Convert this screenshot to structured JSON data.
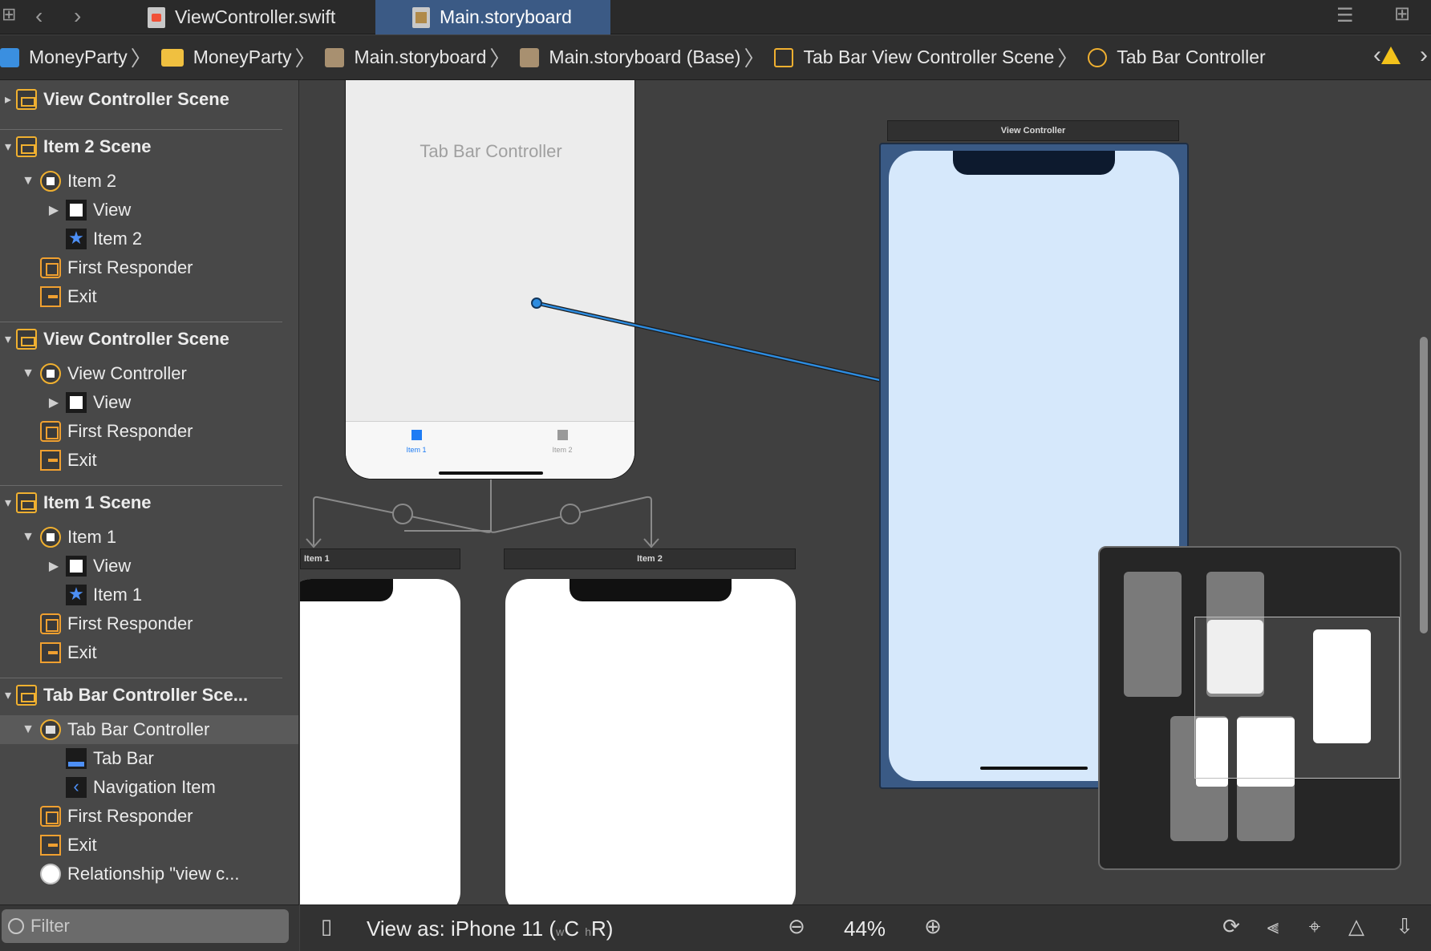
{
  "tabs": [
    {
      "label": "ViewController.swift",
      "active": false,
      "icon": "swift-file-icon"
    },
    {
      "label": "Main.storyboard",
      "active": true,
      "icon": "storyboard-file-icon"
    }
  ],
  "breadcrumb": [
    {
      "label": "MoneyParty",
      "icon": "app-icon"
    },
    {
      "label": "MoneyParty",
      "icon": "folder-icon"
    },
    {
      "label": "Main.storyboard",
      "icon": "storyboard-file-icon"
    },
    {
      "label": "Main.storyboard (Base)",
      "icon": "storyboard-file-icon"
    },
    {
      "label": "Tab Bar View Controller Scene",
      "icon": "scene-icon"
    },
    {
      "label": "Tab Bar Controller",
      "icon": "tab-bar-controller-icon"
    }
  ],
  "outline": {
    "rows": [
      {
        "label": "View Controller Scene",
        "indent": 0,
        "icon": "scene",
        "tri": "▸",
        "bold": true
      },
      {
        "label": "Item 2 Scene",
        "indent": 0,
        "icon": "scene",
        "tri": "▾",
        "bold": true
      },
      {
        "label": "Item 2",
        "indent": 1,
        "icon": "vc",
        "tri": "▼"
      },
      {
        "label": "View",
        "indent": 2,
        "icon": "view",
        "tri": "▶"
      },
      {
        "label": "Item 2",
        "indent": 2,
        "icon": "star",
        "tri": ""
      },
      {
        "label": "First Responder",
        "indent": 1,
        "icon": "cube",
        "tri": ""
      },
      {
        "label": "Exit",
        "indent": 1,
        "icon": "exit",
        "tri": ""
      },
      {
        "label": "View Controller Scene",
        "indent": 0,
        "icon": "scene",
        "tri": "▾",
        "bold": true
      },
      {
        "label": "View Controller",
        "indent": 1,
        "icon": "vc",
        "tri": "▼"
      },
      {
        "label": "View",
        "indent": 2,
        "icon": "view",
        "tri": "▶"
      },
      {
        "label": "First Responder",
        "indent": 1,
        "icon": "cube",
        "tri": ""
      },
      {
        "label": "Exit",
        "indent": 1,
        "icon": "exit",
        "tri": ""
      },
      {
        "label": "Item 1 Scene",
        "indent": 0,
        "icon": "scene",
        "tri": "▾",
        "bold": true
      },
      {
        "label": "Item 1",
        "indent": 1,
        "icon": "vc",
        "tri": "▼"
      },
      {
        "label": "View",
        "indent": 2,
        "icon": "view",
        "tri": "▶"
      },
      {
        "label": "Item 1",
        "indent": 2,
        "icon": "star",
        "tri": ""
      },
      {
        "label": "First Responder",
        "indent": 1,
        "icon": "cube",
        "tri": ""
      },
      {
        "label": "Exit",
        "indent": 1,
        "icon": "exit",
        "tri": ""
      },
      {
        "label": "Tab Bar Controller Sce...",
        "indent": 0,
        "icon": "scene",
        "tri": "▾",
        "bold": true
      },
      {
        "label": "Tab Bar Controller",
        "indent": 1,
        "icon": "tbcico",
        "tri": "▼",
        "selected": true
      },
      {
        "label": "Tab Bar",
        "indent": 2,
        "icon": "tbar",
        "tri": ""
      },
      {
        "label": "Navigation Item",
        "indent": 2,
        "icon": "navitem",
        "tri": ""
      },
      {
        "label": "First Responder",
        "indent": 1,
        "icon": "cube",
        "tri": ""
      },
      {
        "label": "Exit",
        "indent": 1,
        "icon": "exit",
        "tri": ""
      },
      {
        "label": "Relationship \"view c...",
        "indent": 1,
        "icon": "rel",
        "tri": ""
      }
    ],
    "filter_placeholder": "Filter"
  },
  "canvas": {
    "tab_bar_controller_title": "Tab Bar Controller",
    "tab_item_1": "Item 1",
    "tab_item_2": "Item 2",
    "scene_item1": "Item 1",
    "scene_item2": "Item 2",
    "scene_view_controller": "View Controller"
  },
  "bottom": {
    "view_as": "View as: iPhone 11 (",
    "size_w": "w",
    "size_c": "C",
    "size_h": "h",
    "size_r": "R",
    "size_close": ")",
    "zoom": "44%"
  },
  "colors": {
    "accent": "#3b5a85",
    "selection_blue": "#d6e8fb",
    "segue": "#2d8ce0",
    "tab_selected": "#1e7cf4"
  }
}
